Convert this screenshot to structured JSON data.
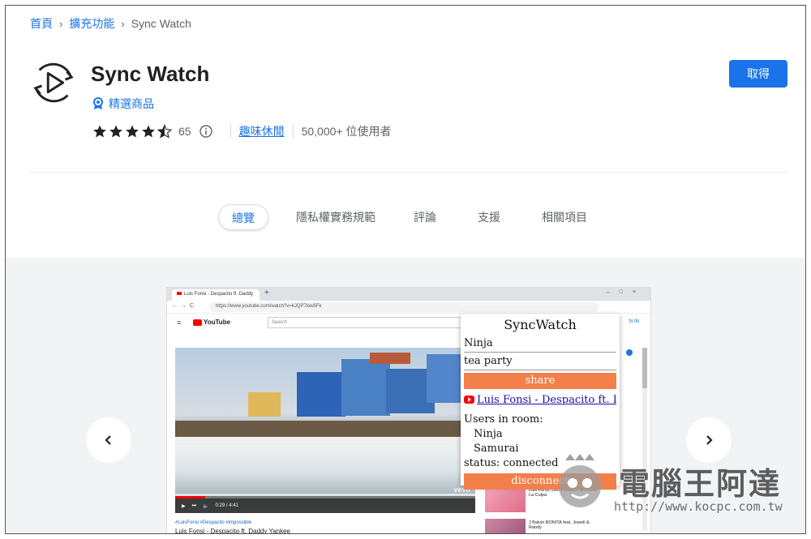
{
  "breadcrumb": {
    "home": "首頁",
    "extensions": "擴充功能",
    "current": "Sync Watch"
  },
  "app": {
    "title": "Sync Watch",
    "featured_label": "精選商品",
    "rating": 4.5,
    "rating_count": "65",
    "category": "趣味休閒",
    "users": "50,000+ 位使用者",
    "remove_button": "取得"
  },
  "tabs": [
    {
      "label": "總覽",
      "active": true
    },
    {
      "label": "隱私權實務規範",
      "active": false
    },
    {
      "label": "評論",
      "active": false
    },
    {
      "label": "支援",
      "active": false
    },
    {
      "label": "相關項目",
      "active": false
    }
  ],
  "screenshot": {
    "browser_tab": "Luis Fonsi - Despacito ft. Daddy",
    "url": "https://www.youtube.com/watch?v=kJQP7kiw5Fk",
    "yt_logo": "YouTube",
    "yt_search_placeholder": "Search",
    "yt_signin": "N IN",
    "video_time": "0:29 / 4:41",
    "video_progress": 0.1,
    "vevo": "vevo",
    "hashtags": "#LuisFonsi #Despacito #impossible",
    "video_title": "Luis Fonsi - Despacito ft. Daddy Yankee",
    "sidebar": [
      {
        "title": "Luis Fonsi, Demi Lovato - Échame La Culpa"
      },
      {
        "title": "J Balvin BONITA feat. Jowell & Randy"
      }
    ]
  },
  "popup": {
    "title": "SyncWatch",
    "name": "Ninja",
    "room": "tea party",
    "share_button": "share",
    "video_link": "Luis Fonsi - Despacito ft. Da...",
    "users_label": "Users in room:",
    "users": [
      "Ninja",
      "Samurai"
    ],
    "status": "status: connected",
    "disconnect_button": "disconnect"
  },
  "watermark": {
    "title": "電腦王阿達",
    "url": "http://www.kocpc.com.tw"
  },
  "colors": {
    "accent": "#1a73e8",
    "popup_button": "#f37f4b",
    "gallery_bg": "#f1f3f4"
  },
  "icons": {
    "app_icon": "sync-play-icon",
    "featured": "featured-badge-icon",
    "info": "info-icon",
    "prev": "chevron-left-icon",
    "next": "chevron-right-icon"
  }
}
